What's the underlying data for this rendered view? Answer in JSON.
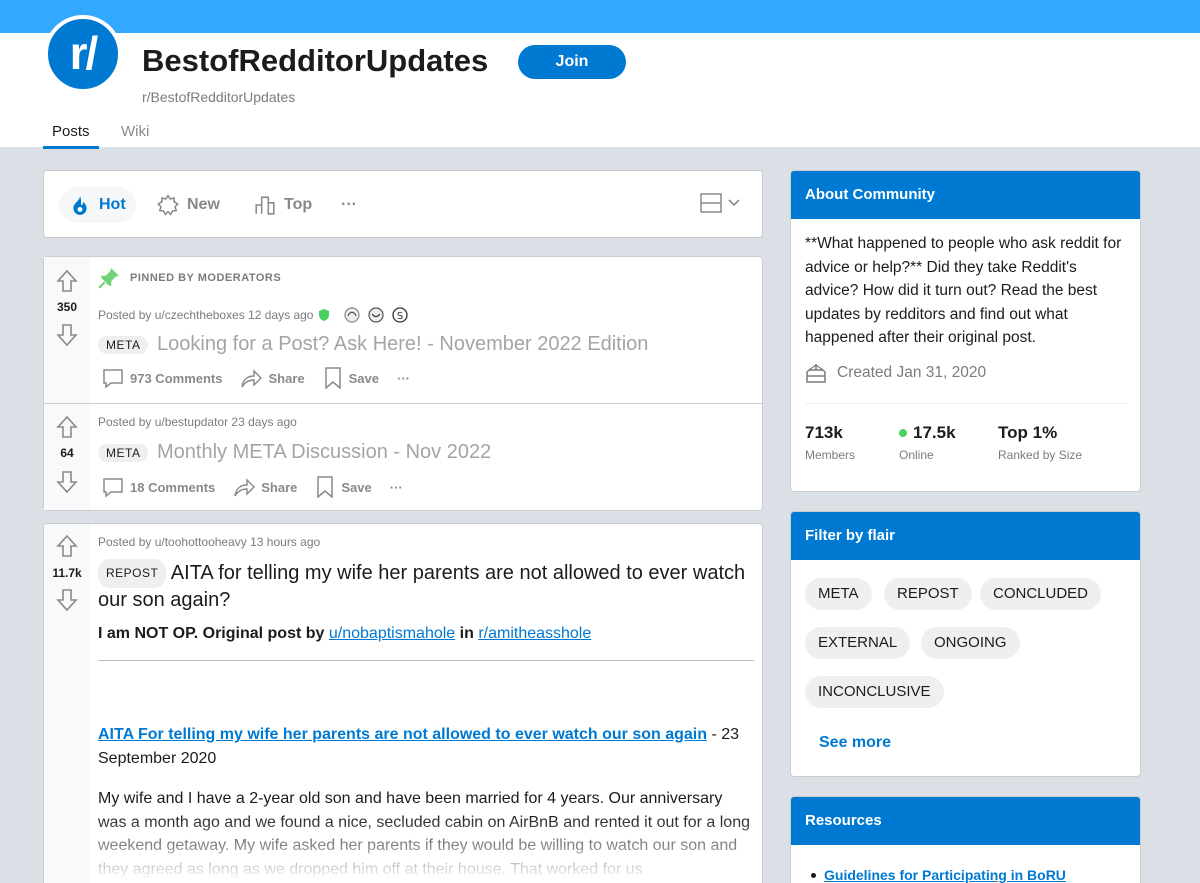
{
  "subreddit": {
    "icon_text": "r/",
    "title": "BestofRedditorUpdates",
    "join_label": "Join",
    "name": "r/BestofRedditorUpdates",
    "tabs": [
      {
        "label": "Posts"
      },
      {
        "label": "Wiki"
      }
    ]
  },
  "sort": {
    "items": [
      {
        "label": "Hot"
      },
      {
        "label": "New"
      },
      {
        "label": "Top"
      }
    ],
    "more": "···"
  },
  "posts": [
    {
      "pinned_label": "PINNED BY MODERATORS",
      "score": "350",
      "posted_by": "Posted by u/czechtheboxes 12 days ago",
      "flair": "META",
      "title": "Looking for a Post? Ask Here! - November 2022 Edition",
      "comments": "973 Comments",
      "share": "Share",
      "save": "Save",
      "more": "···"
    },
    {
      "score": "64",
      "posted_by": "Posted by u/bestupdator 23 days ago",
      "flair": "META",
      "title": "Monthly META Discussion - Nov 2022",
      "comments": "18 Comments",
      "share": "Share",
      "save": "Save",
      "more": "···"
    },
    {
      "score": "11.7k",
      "posted_by": "Posted by u/toohottooheavy 13 hours ago",
      "flair": "REPOST",
      "title": "AITA for telling my wife her parents are not allowed to ever watch our son again?",
      "intro_prefix": "I am NOT OP. Original post by",
      "intro_user": "u/nobaptismahole",
      "intro_in": "in",
      "intro_sub": "r/amitheasshole",
      "link_text": "AITA For telling my wife her parents are not allowed to ever watch our son again",
      "link_suffix": " - 23 September 2020",
      "paragraph": "My wife and I have a 2-year old son and have been married for 4 years. Our anniversary was a month ago and we found a nice, secluded cabin on AirBnB and rented it out for a long weekend getaway. My wife asked her parents if they would be willing to watch our son and they agreed as long as we dropped him off at their house. That worked for us"
    }
  ],
  "about": {
    "header": "About Community",
    "description": "**What happened to people who ask reddit for advice or help?** Did they take Reddit's advice? How did it turn out? Read the best updates by redditors and find out what happened after their original post.",
    "created": "Created Jan 31, 2020",
    "members_num": "713k",
    "members_label": "Members",
    "online_num": "17.5k",
    "online_label": "Online",
    "rank_num": "Top 1%",
    "rank_label": "Ranked by Size"
  },
  "flair_filter": {
    "header": "Filter by flair",
    "chips": [
      "META",
      "REPOST",
      "CONCLUDED",
      "EXTERNAL",
      "ONGOING",
      "INCONCLUSIVE"
    ],
    "see_more": "See more"
  },
  "resources": {
    "header": "Resources",
    "items": [
      "Guidelines for Participating in BoRU"
    ]
  },
  "colors": {
    "brand_blue": "#0079d3",
    "banner": "#33a8ff",
    "background": "#dae0e6",
    "pin_green": "#75d377",
    "online_green": "#46d160"
  }
}
